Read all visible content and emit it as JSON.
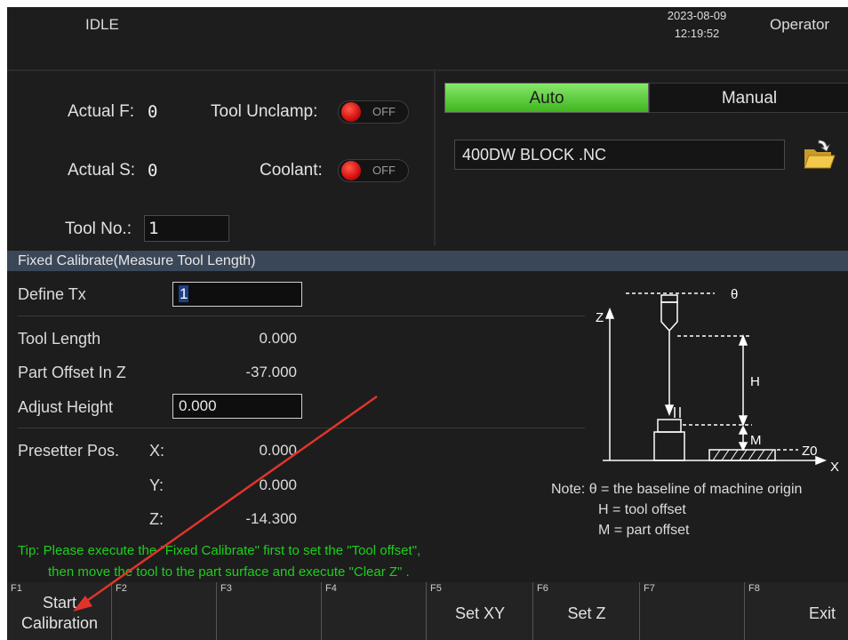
{
  "topbar": {
    "state": "IDLE",
    "date": "2023-08-09",
    "time": "12:19:52",
    "user": "Operator"
  },
  "status": {
    "actual_f_label": "Actual F:",
    "actual_f_value": "0",
    "actual_s_label": "Actual S:",
    "actual_s_value": "0",
    "tool_no_label": "Tool No.:",
    "tool_no_value": "1",
    "tool_unclamp_label": "Tool Unclamp:",
    "tool_unclamp_state": "OFF",
    "coolant_label": "Coolant:",
    "coolant_state": "OFF"
  },
  "mode": {
    "auto_label": "Auto",
    "manual_label": "Manual",
    "active": "Auto",
    "active_color": "#4cc22a"
  },
  "file": {
    "name": "400DW BLOCK .NC",
    "icon": "folder-open-icon"
  },
  "section": {
    "title": "Fixed Calibrate(Measure Tool Length)"
  },
  "form": {
    "define_tx_label": "Define Tx",
    "define_tx_value": "1",
    "tool_length_label": "Tool Length",
    "tool_length_value": "0.000",
    "part_offset_label": "Part Offset In Z",
    "part_offset_value": "-37.000",
    "adjust_height_label": "Adjust Height",
    "adjust_height_value": "0.000",
    "presetter_label": "Presetter Pos.",
    "x_label": "X:",
    "x_value": "0.000",
    "y_label": "Y:",
    "y_value": "0.000",
    "z_label": "Z:",
    "z_value": "-14.300"
  },
  "diagram": {
    "theta": "θ",
    "z_axis": "Z",
    "x_axis": "X",
    "h": "H",
    "m": "M",
    "z0": "Z0"
  },
  "note": {
    "line1": "Note: θ = the baseline of machine origin",
    "line2": "H = tool offset",
    "line3": "M = part offset"
  },
  "tip": {
    "line1": "Tip: Please execute the \"Fixed Calibrate\" first to set the \"Tool offset\",",
    "line2": "then move the tool to the part surface and execute \"Clear Z\" ."
  },
  "fkeys": [
    {
      "num": "F1",
      "line1": "Start",
      "line2": "Calibration"
    },
    {
      "num": "F2",
      "line1": "",
      "line2": ""
    },
    {
      "num": "F3",
      "line1": "",
      "line2": ""
    },
    {
      "num": "F4",
      "line1": "",
      "line2": ""
    },
    {
      "num": "F5",
      "line1": "Set XY",
      "line2": ""
    },
    {
      "num": "F6",
      "line1": "Set Z",
      "line2": ""
    },
    {
      "num": "F7",
      "line1": "",
      "line2": ""
    },
    {
      "num": "F8",
      "line1": "Exit",
      "line2": ""
    }
  ],
  "overlay": {
    "arrow_color": "#e0342a"
  }
}
